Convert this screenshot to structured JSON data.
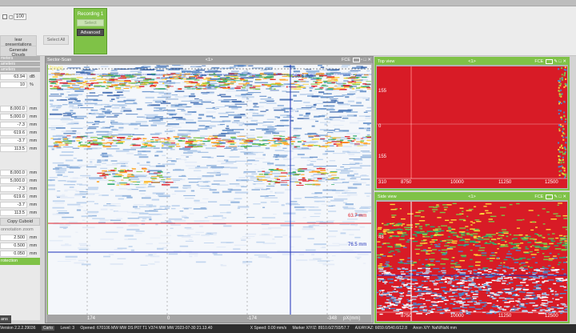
{
  "top_controls": {
    "range_value": "100",
    "btn_clear_presentations": "lear presentations",
    "btn_select_all": "Select All",
    "btn_generate_clouds": "Generate Clouds"
  },
  "recording": {
    "title": "Recording 1",
    "select_label": "Select",
    "advanced_label": "Advanced"
  },
  "left_panel": {
    "headers": [
      "meters",
      "ameters",
      "ameters"
    ],
    "group1": [
      {
        "value": "63.94",
        "unit": "dB"
      },
      {
        "value": "10",
        "unit": "%"
      }
    ],
    "group2": [
      {
        "value": "8,000.0",
        "unit": "mm"
      },
      {
        "value": "5,000.0",
        "unit": "mm"
      },
      {
        "value": "-7.3",
        "unit": "mm"
      },
      {
        "value": "619.6",
        "unit": "mm"
      },
      {
        "value": "-3.7",
        "unit": "mm"
      },
      {
        "value": "113.5",
        "unit": "mm"
      }
    ],
    "group3": [
      {
        "value": "8,000.0",
        "unit": "mm"
      },
      {
        "value": "5,000.0",
        "unit": "mm"
      },
      {
        "value": "-7.3",
        "unit": "mm"
      },
      {
        "value": "619.6",
        "unit": "mm"
      },
      {
        "value": "-3.7",
        "unit": "mm"
      },
      {
        "value": "113.5",
        "unit": "mm"
      }
    ],
    "copy_cuboid": "Copy Cuboid",
    "annotation_zoom": "onnotation zoom",
    "group4": [
      {
        "value": "2.500",
        "unit": "mm"
      },
      {
        "value": "0.500",
        "unit": "mm"
      },
      {
        "value": "0.050",
        "unit": "mm"
      }
    ],
    "green_label": "rotection",
    "bottom_tab": "ans"
  },
  "sector_scan": {
    "title": "Sector-Scan",
    "index": "<1>",
    "mode": "FCE",
    "axis_z": "Z(mm)",
    "cursor_top": "260.6 mm",
    "cursor_red": "63.7 mm",
    "cursor_blue": "76.5 mm",
    "x_ticks": [
      "174",
      "0",
      "-174",
      "-348"
    ],
    "x_unit": "pX(mm)"
  },
  "top_view": {
    "title": "Top view",
    "index": "<1>",
    "mode": "FCE",
    "y_ticks": [
      "155",
      "0",
      "155",
      "310"
    ],
    "x_ticks": [
      "8750",
      "10000",
      "11250",
      "12500"
    ]
  },
  "side_view": {
    "title": "Side view",
    "index": "<1>",
    "mode": "FCE",
    "y_ticks": [
      "48",
      "72"
    ],
    "x_ticks": [
      "8750",
      "10000",
      "11250",
      "12500"
    ]
  },
  "status_bar": {
    "version": "Version 2.2.2.29036",
    "mode_badge": "Carto",
    "level": "Level: 3",
    "opened": "Opened: 670106 MW MW DS P07 T1 V374 MW MW 2023-07-30 21.13.40",
    "speed": "X Speed: 0.00 mm/s",
    "marker": "Marker X/Y/Z: 8910.6/2793/57.7",
    "ax": "AX/AY/AZ: 6659.6/540.6/12.8",
    "anon": "Anon X/Y: NaN/NaN mm"
  },
  "colors": {
    "accent_green": "#7fc247",
    "panel_gray": "#9d9d9d",
    "cursor_red": "#e0202a",
    "cursor_blue": "#1d2fb8",
    "scan_red": "#d81b26"
  }
}
